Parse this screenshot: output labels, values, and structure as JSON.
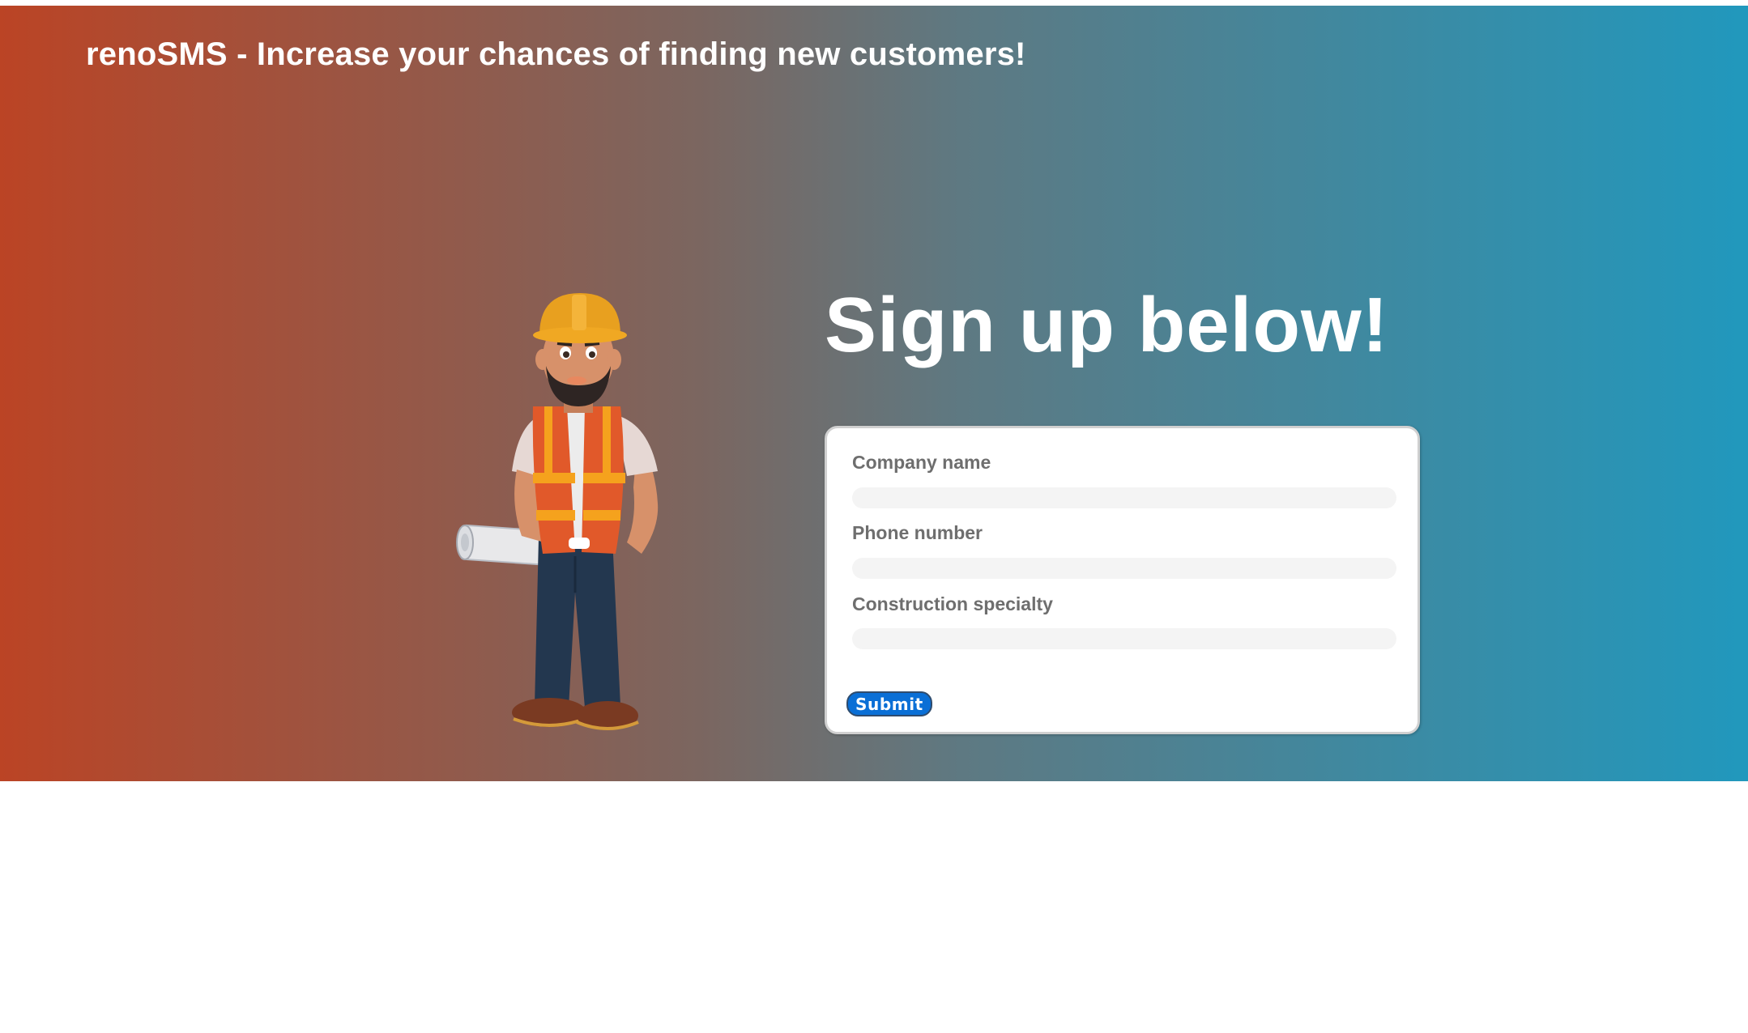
{
  "header": {
    "title": "renoSMS - Increase your chances of finding new customers!"
  },
  "hero": {
    "heading": "Sign up below!",
    "illustration": "construction-worker-illustration"
  },
  "form": {
    "fields": [
      {
        "label": "Company name",
        "value": ""
      },
      {
        "label": "Phone number",
        "value": ""
      },
      {
        "label": "Construction specialty",
        "value": ""
      }
    ],
    "submit_label": "Submit"
  },
  "colors": {
    "gradient_start": "#bb4425",
    "gradient_end": "#2198bd",
    "button": "#0a6fd6",
    "text_light": "#ffffff",
    "label": "#6e6e6e"
  }
}
